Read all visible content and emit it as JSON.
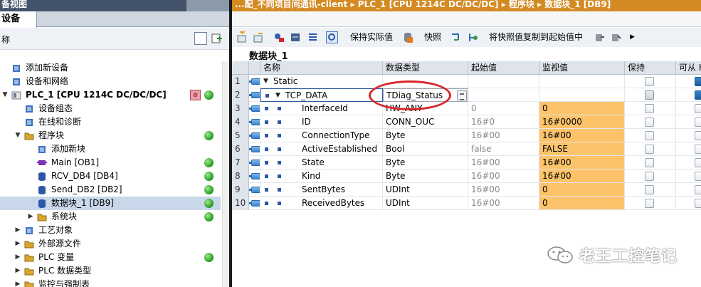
{
  "left_panel": {
    "title": "备视图",
    "tab": "设备",
    "toolbar_hint": "称",
    "tree": [
      {
        "label": "添加新设备",
        "icon": "add-device-icon",
        "indent": 0,
        "arrow": ""
      },
      {
        "label": "设备和网络",
        "icon": "network-icon",
        "indent": 0,
        "arrow": ""
      },
      {
        "label": "PLC_1 [CPU 1214C DC/DC/DC]",
        "icon": "plc-icon",
        "indent": 0,
        "arrow": "▼",
        "status": "ok",
        "warning": true,
        "bold": true
      },
      {
        "label": "设备组态",
        "icon": "device-config-icon",
        "indent": 1,
        "arrow": ""
      },
      {
        "label": "在线和诊断",
        "icon": "diagnostics-icon",
        "indent": 1,
        "arrow": ""
      },
      {
        "label": "程序块",
        "icon": "folder-icon",
        "indent": 1,
        "arrow": "▼",
        "status": "ok"
      },
      {
        "label": "添加新块",
        "icon": "add-block-icon",
        "indent": 2,
        "arrow": ""
      },
      {
        "label": "Main [OB1]",
        "icon": "ob-icon",
        "indent": 2,
        "arrow": "",
        "status": "ok"
      },
      {
        "label": "RCV_DB4 [DB4]",
        "icon": "db-icon",
        "indent": 2,
        "arrow": "",
        "status": "ok"
      },
      {
        "label": "Send_DB2 [DB2]",
        "icon": "db-icon",
        "indent": 2,
        "arrow": "",
        "status": "ok"
      },
      {
        "label": "数据块_1 [DB9]",
        "icon": "db-icon",
        "indent": 2,
        "arrow": "",
        "status": "ok",
        "selected": true
      },
      {
        "label": "系统块",
        "icon": "folder-icon",
        "indent": 2,
        "arrow": "▶",
        "status": "ok"
      },
      {
        "label": "工艺对象",
        "icon": "technology-icon",
        "indent": 1,
        "arrow": "▶"
      },
      {
        "label": "外部源文件",
        "icon": "folder-icon",
        "indent": 1,
        "arrow": "▶"
      },
      {
        "label": "PLC 变量",
        "icon": "folder-icon",
        "indent": 1,
        "arrow": "▶",
        "status": "ok"
      },
      {
        "label": "PLC 数据类型",
        "icon": "folder-icon",
        "indent": 1,
        "arrow": "▶"
      },
      {
        "label": "监控与强制表",
        "icon": "folder-icon",
        "indent": 1,
        "arrow": "▶"
      }
    ]
  },
  "editor": {
    "breadcrumb": "...配_不同项目间通讯-client  ▸  PLC_1 [CPU 1214C DC/DC/DC]  ▸  程序块  ▸  数据块_1 [DB9]",
    "toolbar": {
      "keep_actual": "保持实际值",
      "snapshot": "快照",
      "copy_snapshot": "将快照值复制到起始值中"
    },
    "block_title": "数据块_1",
    "columns": [
      "名称",
      "数据类型",
      "起始值",
      "监视值",
      "保持",
      "可从 H"
    ],
    "rows": [
      {
        "num": "1",
        "name": "Static",
        "type": "",
        "start": "",
        "monitor": "",
        "level": 0,
        "arrow": "▼"
      },
      {
        "num": "2",
        "name": "TCP_DATA",
        "type": "TDiag_Status",
        "start": "",
        "monitor": "",
        "level": 1,
        "arrow": "▼",
        "selected": true
      },
      {
        "num": "3",
        "name": "InterfaceId",
        "type": "HW_ANY",
        "start": "0",
        "monitor": "0",
        "level": 2
      },
      {
        "num": "4",
        "name": "ID",
        "type": "CONN_OUC",
        "start": "16#0",
        "monitor": "16#0000",
        "level": 2
      },
      {
        "num": "5",
        "name": "ConnectionType",
        "type": "Byte",
        "start": "16#00",
        "monitor": "16#00",
        "level": 2
      },
      {
        "num": "6",
        "name": "ActiveEstablished",
        "type": "Bool",
        "start": "false",
        "monitor": "FALSE",
        "level": 2
      },
      {
        "num": "7",
        "name": "State",
        "type": "Byte",
        "start": "16#00",
        "monitor": "16#00",
        "level": 2
      },
      {
        "num": "8",
        "name": "Kind",
        "type": "Byte",
        "start": "16#00",
        "monitor": "16#00",
        "level": 2
      },
      {
        "num": "9",
        "name": "SentBytes",
        "type": "UDInt",
        "start": "16#00",
        "monitor": "0",
        "level": 2
      },
      {
        "num": "10",
        "name": "ReceivedBytes",
        "type": "UDInt",
        "start": "16#00",
        "monitor": "0",
        "level": 2
      }
    ]
  },
  "watermark": "老王工控笔记",
  "colors": {
    "accent": "#d48a22",
    "monitor_cell": "#fdc36a",
    "header_bg": "#dfe4ea",
    "selection": "#c8d7ea",
    "highlight_oval": "#d8262b"
  }
}
